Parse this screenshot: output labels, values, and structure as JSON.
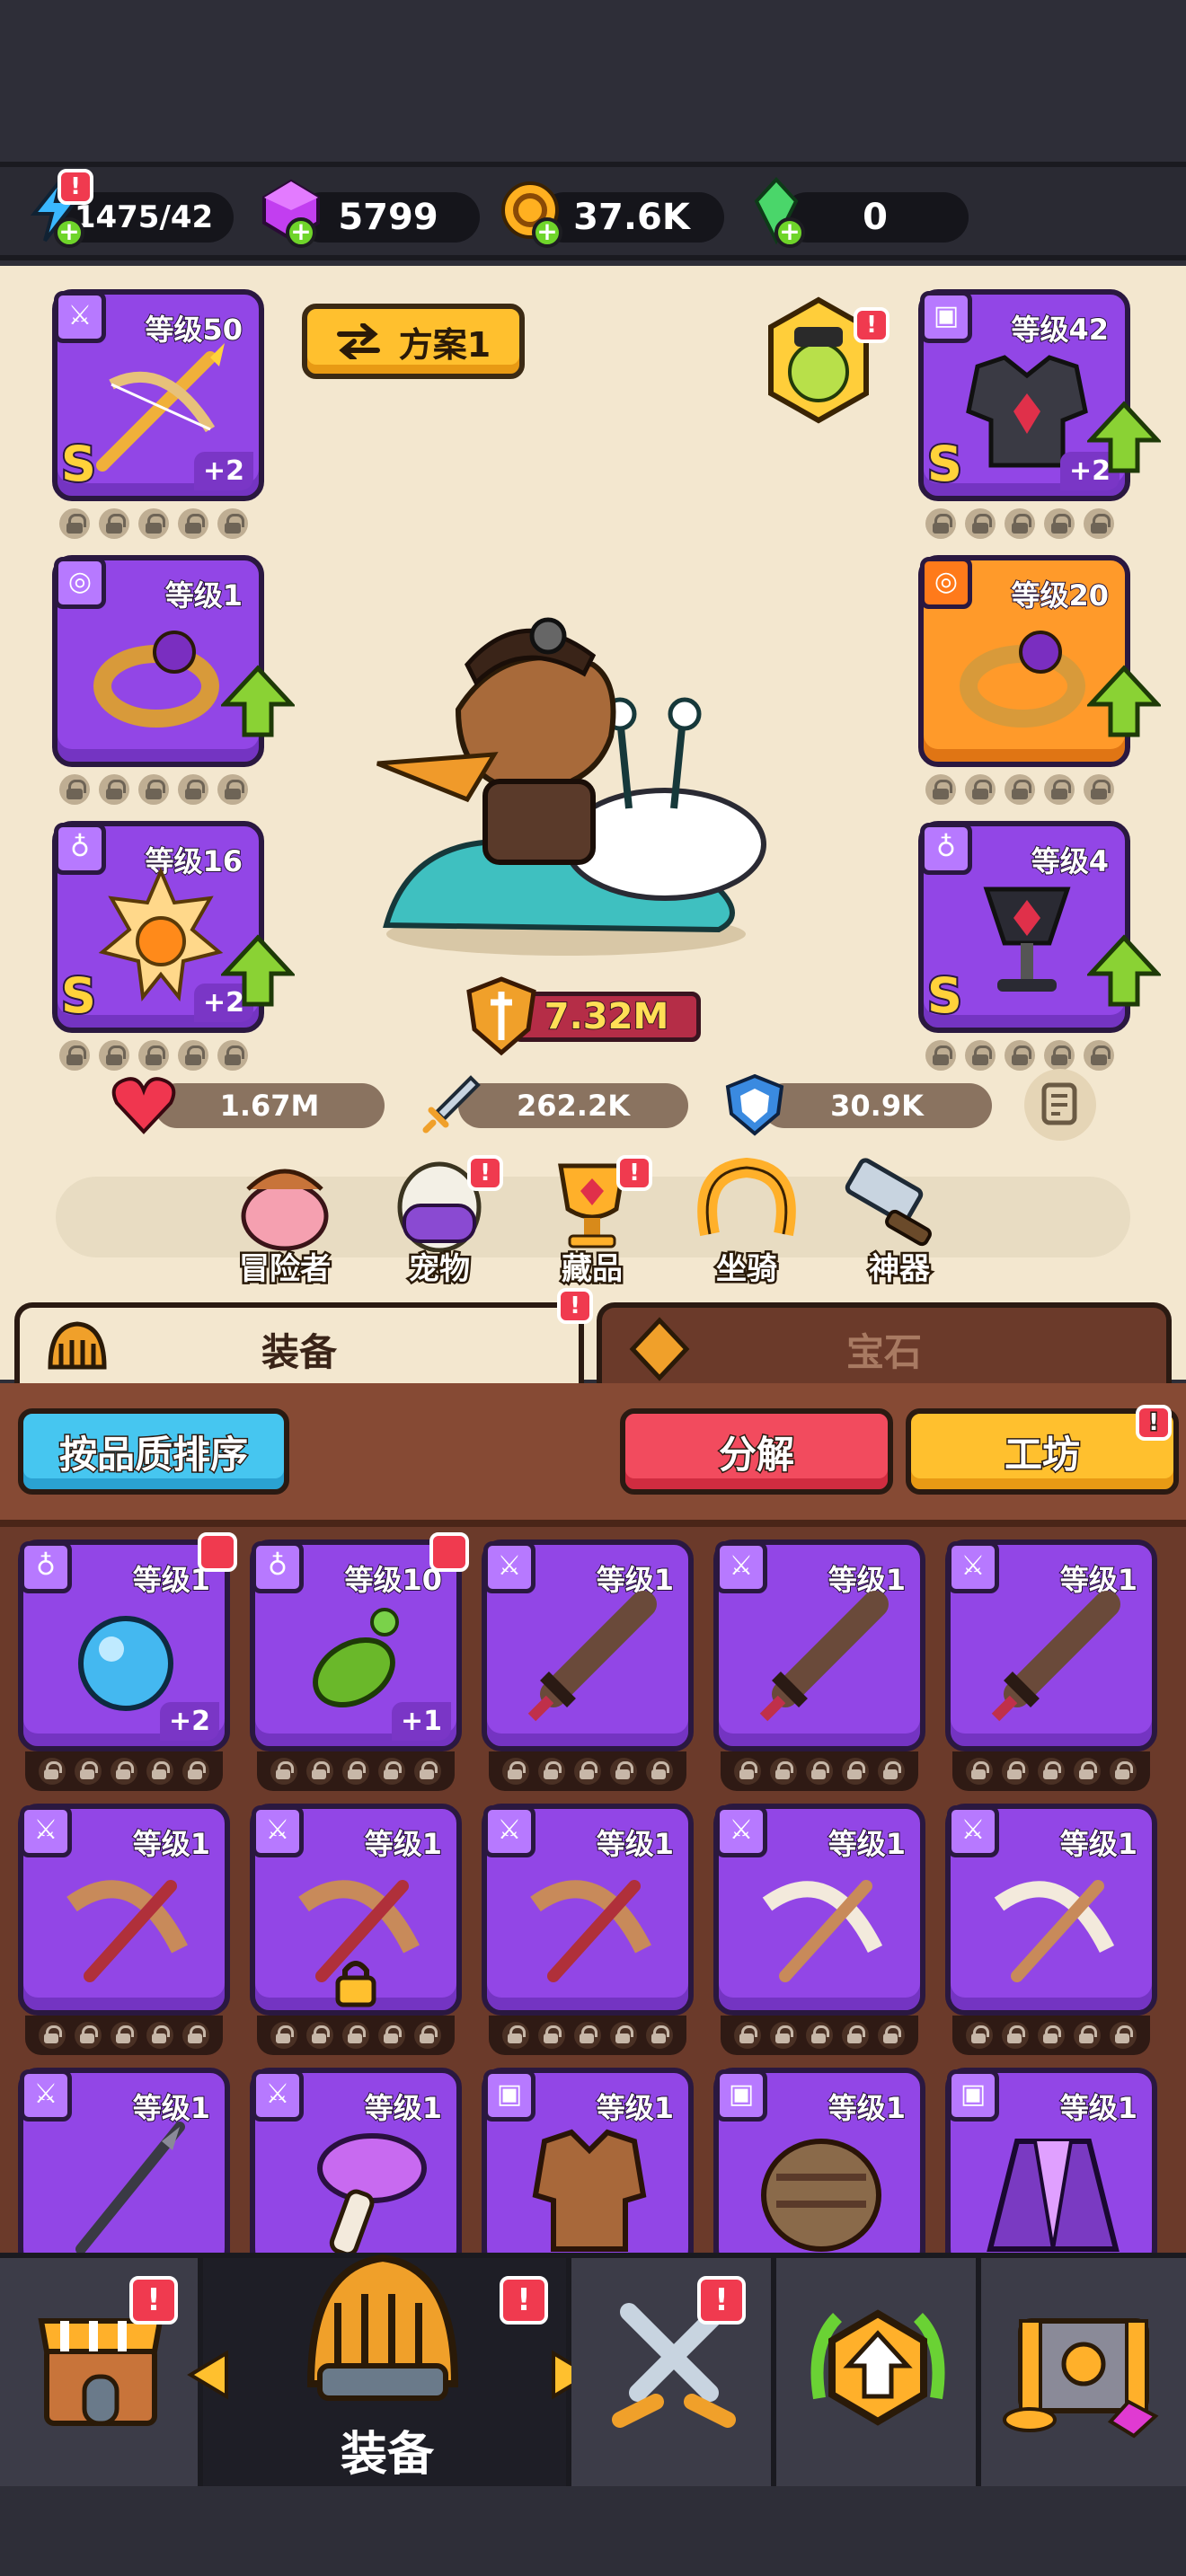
{
  "resources": {
    "energy": "1475/42",
    "gems": "5799",
    "gold": "37.6K",
    "crystals": "0"
  },
  "hero": {
    "plan_label": "方案1",
    "power": "7.32M",
    "stats": {
      "hp": "1.67M",
      "attack": "262.2K",
      "defense": "30.9K"
    }
  },
  "equipped": {
    "left": [
      {
        "level": "等级50",
        "plus": "+2",
        "grade": "S",
        "icon": "sword-tag-icon",
        "item": "crossbow-icon"
      },
      {
        "level": "等级1",
        "plus": "",
        "grade": "",
        "icon": "ring-tag-icon",
        "item": "ring-icon"
      },
      {
        "level": "等级16",
        "plus": "+2",
        "grade": "S",
        "icon": "amulet-tag-icon",
        "item": "sun-amulet-icon"
      }
    ],
    "right": [
      {
        "level": "等级42",
        "plus": "+2",
        "grade": "S",
        "icon": "armor-tag-icon",
        "item": "dark-armor-icon"
      },
      {
        "level": "等级20",
        "plus": "",
        "grade": "",
        "icon": "ring-tag-icon",
        "item": "ring-icon"
      },
      {
        "level": "等级4",
        "plus": "",
        "grade": "S",
        "icon": "amulet-tag-icon",
        "item": "chalice-icon"
      }
    ]
  },
  "nav_items": [
    "冒险者",
    "宠物",
    "藏品",
    "坐骑",
    "神器"
  ],
  "tabs": {
    "equipment": "装备",
    "gems": "宝石"
  },
  "toolbar": {
    "sort": "按品质排序",
    "dismantle": "分解",
    "workshop": "工坊"
  },
  "inventory": [
    {
      "level": "等级1",
      "plus": "+2",
      "icon": "amulet-tag-icon",
      "item": "blue-orb-icon"
    },
    {
      "level": "等级10",
      "plus": "+1",
      "icon": "amulet-tag-icon",
      "item": "green-pendant-icon"
    },
    {
      "level": "等级1",
      "plus": "",
      "icon": "sword-tag-icon",
      "item": "wooden-sword-icon"
    },
    {
      "level": "等级1",
      "plus": "",
      "icon": "sword-tag-icon",
      "item": "wooden-sword-icon"
    },
    {
      "level": "等级1",
      "plus": "",
      "icon": "sword-tag-icon",
      "item": "wooden-sword-icon"
    },
    {
      "level": "等级1",
      "plus": "",
      "icon": "sword-tag-icon",
      "item": "red-crossbow-icon"
    },
    {
      "level": "等级1",
      "plus": "",
      "icon": "sword-tag-icon",
      "item": "red-crossbow-icon"
    },
    {
      "level": "等级1",
      "plus": "",
      "icon": "sword-tag-icon",
      "item": "red-crossbow-icon"
    },
    {
      "level": "等级1",
      "plus": "",
      "icon": "sword-tag-icon",
      "item": "bone-crossbow-icon"
    },
    {
      "level": "等级1",
      "plus": "",
      "icon": "sword-tag-icon",
      "item": "bone-crossbow-icon"
    },
    {
      "level": "等级1",
      "plus": "",
      "icon": "sword-tag-icon",
      "item": "spear-icon"
    },
    {
      "level": "等级1",
      "plus": "",
      "icon": "sword-tag-icon",
      "item": "mushroom-staff-icon"
    },
    {
      "level": "等级1",
      "plus": "",
      "icon": "armor-tag-icon",
      "item": "leather-armor-icon"
    },
    {
      "level": "等级1",
      "plus": "",
      "icon": "armor-tag-icon",
      "item": "fur-armor-icon"
    },
    {
      "level": "等级1",
      "plus": "",
      "icon": "armor-tag-icon",
      "item": "purple-cape-icon"
    }
  ],
  "bottom_nav": {
    "active_label": "装备"
  },
  "colors": {
    "epic_purple": "#9246e6",
    "legend_orange": "#ff9a2a",
    "alert_red": "#f03a4f",
    "panel_cream": "#f3e7cf",
    "inventory_brown": "#6b3a2a"
  }
}
